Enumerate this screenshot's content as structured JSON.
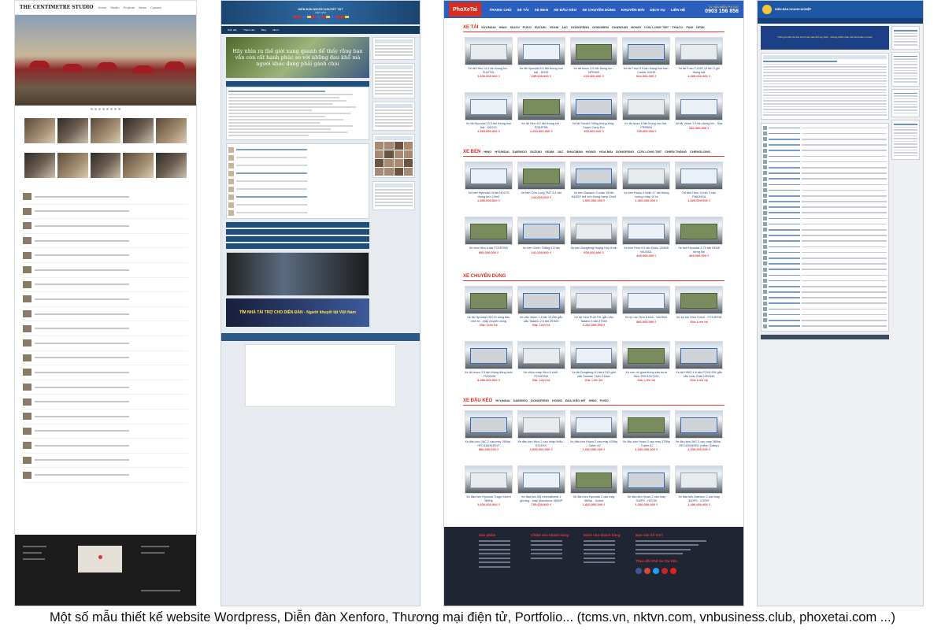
{
  "caption": "Một số mẫu thiết kế website Wordpress, Diễn đàn Xenforo, Thương mại điện tử, Portfolio... (tcms.vn, nktvn.com, vnbusiness.club, phoxetai.com ...)",
  "portfolio": {
    "logo": "THE CENTIMETRE STUDIO",
    "nav": [
      "Home",
      "Studio",
      "Projects",
      "News",
      "Contact"
    ]
  },
  "forum": {
    "banner_title": "DIỄN ĐÀN NGƯỜI KHUYẾT TẬT",
    "banner_subtitle": "VIỆT NAM",
    "nav": [
      "Diễn đàn",
      "Thành viên",
      "Blog",
      "Album"
    ],
    "slide_text": "Hãy nhìn ra thế giới xung quanh để thấy rằng bạn vẫn còn rất hạnh phúc so với những đau khổ mà người khác đang phải gánh chịu",
    "sponsor_text": "TÌM NHÀ TÀI TRỢ CHO DIỄN ĐÀN - Người khuyết tật Việt Nam"
  },
  "shop": {
    "brand": "PhoXeTai",
    "brand_sub": "XE TẢI",
    "menu": [
      "TRANG CHỦ",
      "XE TẢI",
      "XE BEN",
      "XE ĐẦU KÉO",
      "XE CHUYÊN DÙNG",
      "KHUYẾN MÃI",
      "DỊCH VỤ",
      "LIÊN HỆ"
    ],
    "hotline_label": "TƯ VẤN MIỄN PHÍ 24/7",
    "hotline": "0903 156 856",
    "categories": [
      {
        "title": "XE TẢI",
        "subs": [
          "HYUNDAI",
          "HINO",
          "ISUZU",
          "FUSO",
          "SUZUKI",
          "VEAM",
          "JAC",
          "DONGFENG",
          "DONGBEN",
          "CHANGAN",
          "HOWO",
          "CỬU LONG TMT",
          "THÁCO",
          "FAW",
          "DFSK"
        ],
        "products": [
          {
            "name": "Xe tải Hino 14.4 tấn thùng kín - FL8JTSL",
            "price": "1.630.000.000 ₫"
          },
          {
            "name": "Xe tải Hyundai 6.5 tấn thùng mui bạt - HD99",
            "price": "695.000.000 ₫"
          },
          {
            "name": "Xe tải Isuzu 3.5 tấn thùng kín - NPR400",
            "price": "620.000.000 ₫"
          },
          {
            "name": "Xe tải Fuso 5.5 tấn thùng mui bạt - Canter 8.2HD",
            "price": "664.000.000 ₫"
          },
          {
            "name": "Xe tải Fuso FJ24R 15 tấn 3 giò thùng bạt",
            "price": "1.285.000.000 ₫"
          },
          {
            "name": "Xe tải Hyundai 13.5 tấn thùng mui bạt - HD210",
            "price": "1.365.000.000 ₫"
          },
          {
            "name": "Xe tải Hino 8.2 tấn thùng kín - FG8JPSB",
            "price": "1.254.000.000 ₫"
          },
          {
            "name": "Xe tải Suzuki 740kg thùng lửng - Super Carry Pro",
            "price": "302.000.000 ₫"
          },
          {
            "name": "Xe tải Isuzu 6 tấn thùng mui bạt - FRR90N",
            "price": "735.000.000 ₫"
          },
          {
            "name": "Xe tải Veam 1.9 tấn thùng kín - Star",
            "price": "340.000.000 ₫"
          }
        ]
      },
      {
        "title": "XE BEN",
        "subs": [
          "HINO",
          "HYUNDAI",
          "DAEWOO",
          "SUZUKI",
          "VEAM",
          "JAC",
          "SHACMAN",
          "HOWO",
          "HOA MAI",
          "DONGFENG",
          "CỬU LONG TMT",
          "CHIẾN THẮNG",
          "CHENGLONG"
        ],
        "products": [
          {
            "name": "Xe ben Hyundai 15 tấn HD270 thùng ben 10m3",
            "price": "1.850.000.000 ₫"
          },
          {
            "name": "Xe ben Cửu Long TMT 3.4 tấn",
            "price": "243.000.000 ₫"
          },
          {
            "name": "Xe ben Daewoo 3 chân 15 tấn K4DEF thể tích thùng hàng 10m3",
            "price": "1.000.000.000 ₫"
          },
          {
            "name": "Xe ben Howo 4 chân 17 tấn thùng vuông nhập 10 tà",
            "price": "1.400.000.000 ₫"
          },
          {
            "name": "Xe ben Hino 14 tấn 3 cầu FM8JNSA",
            "price": "1.825.000.000 ₫"
          },
          {
            "name": "Xe ben Hino 6 tấn FC9JESW",
            "price": "855.000.000 ₫"
          },
          {
            "name": "Xe ben Chiến Thắng 4.6 tấn",
            "price": "241.000.000 ₫"
          },
          {
            "name": "Xe ben Dongfeng Hoàng Huy 8 tấn",
            "price": "600.000.000 ₫"
          },
          {
            "name": "Xe ben Hino 6.5 tấn Dutro 130MD WU342L",
            "price": "449.000.000 ₫"
          },
          {
            "name": "Xe ben Hyundai 3.75 tấn HD65 bửng lồn",
            "price": "465.000.000 ₫"
          }
        ]
      },
      {
        "title": "XE CHUYÊN DÙNG",
        "subs": [],
        "products": [
          {
            "name": "Xe tải Hyundai HD210 sàng đầu chở xe - máy chuyên dùng",
            "price": "Giá: Liên hệ"
          },
          {
            "name": "Xe cẩu Veam 1.8 tấn V1260 gắn cẩu Tadano 2.6 tấn ZE300",
            "price": "Giá: Liên hệ"
          },
          {
            "name": "Xe tải Hino FL8JTSL gắn cẩu Tadano 5 tấn ZT500",
            "price": "2.240.000.000 ₫"
          },
          {
            "name": "Xe ép rác Hino 6 khối - WU342L",
            "price": "880.000.000 ₫"
          },
          {
            "name": "Xe ép rác Hino 9 khối - FC9JESW",
            "price": "Giá: Liên hệ"
          },
          {
            "name": "Xe tải Isuzu 3.5 tấn thùng đông lạnh - FVM34W",
            "price": "3.490.000.000 ₫"
          },
          {
            "name": "Xe chữa cháy Hino 6 khối - FC9JESW",
            "price": "Giá: Liên hệ"
          },
          {
            "name": "Xe tải Dongfeng 10 tấn L315 gắn cẩu Soosan 7 tấn 4 khúc",
            "price": "Giá: Liên hệ"
          },
          {
            "name": "Xe cứu hộ giao thông sàn trượt Hino 250 XZU720L",
            "price": "Giá: Liên hệ"
          },
          {
            "name": "Xe tải HINO 4.6 tấn FC9JLSW gắn cẩu Unic 3 tấn URV340",
            "price": "Giá: Liên hệ"
          }
        ]
      },
      {
        "title": "XE ĐẦU KÉO",
        "subs": [
          "HYUNDAI",
          "DAEWOO",
          "DONGFENG",
          "HOWO",
          "ĐẦU KÉO MỸ",
          "HINO",
          "FUSO"
        ],
        "products": [
          {
            "name": "Xe đầu kéo JAC 2 cầu máy 260hp - HFC4180K3R1T",
            "price": "880.000.000 ₫"
          },
          {
            "name": "Xe đầu kéo Hino 2 cầu nhập khẩu - SS1EKV",
            "price": "1.850.000.000 ₫"
          },
          {
            "name": "Xe đầu kéo Howo 2 cầu máy 420hp - Cabin A7",
            "price": "1.030.000.000 ₫"
          },
          {
            "name": "Xe đầu kéo Howo 2 cầu máy 375hp - Cabin A7",
            "price": "1.030.000.000 ₫"
          },
          {
            "name": "Xe đầu kéo JAC 2 cầu máy 380hp - HFC4253K5R1 (cabin Gallop)",
            "price": "1.030.000.000 ₫"
          },
          {
            "name": "Xe đầu kéo Hyundai Trago Xcient 360Hp",
            "price": "1.600.000.000 ₫"
          },
          {
            "name": "Xe đầu kéo Mỹ International 1 giường - máy Maxxforce 450HP",
            "price": "795.000.000 ₫"
          },
          {
            "name": "Xe đầu kéo Hyundai 2 cầu máy 380hp - Xcient",
            "price": "1.820.000.000 ₫"
          },
          {
            "name": "Xe đầu kéo Howo 2 cầu máy 340PS - HD790",
            "price": "1.330.000.000 ₫"
          },
          {
            "name": "Xe đầu kéo Daewoo 2 cầu máy 340PS - V3TEF",
            "price": "1.490.000.000 ₫"
          }
        ]
      }
    ],
    "footer": [
      {
        "heading": "Sản phẩm"
      },
      {
        "heading": "Chăm sóc khách hàng"
      },
      {
        "heading": "Dành cho khách hàng"
      },
      {
        "heading": "Bạn cần hỗ trợ?"
      }
    ],
    "footer_follow": "Theo dõi Phố Xe Tải trên"
  },
  "business": {
    "banner_title": "DIỄN ĐÀN DOANH NGHIỆP",
    "notice": "Thông tin kết nối của Linh hoạt tuân thủ quy định - Không chấp nhận các tài khoản vi phạm"
  }
}
